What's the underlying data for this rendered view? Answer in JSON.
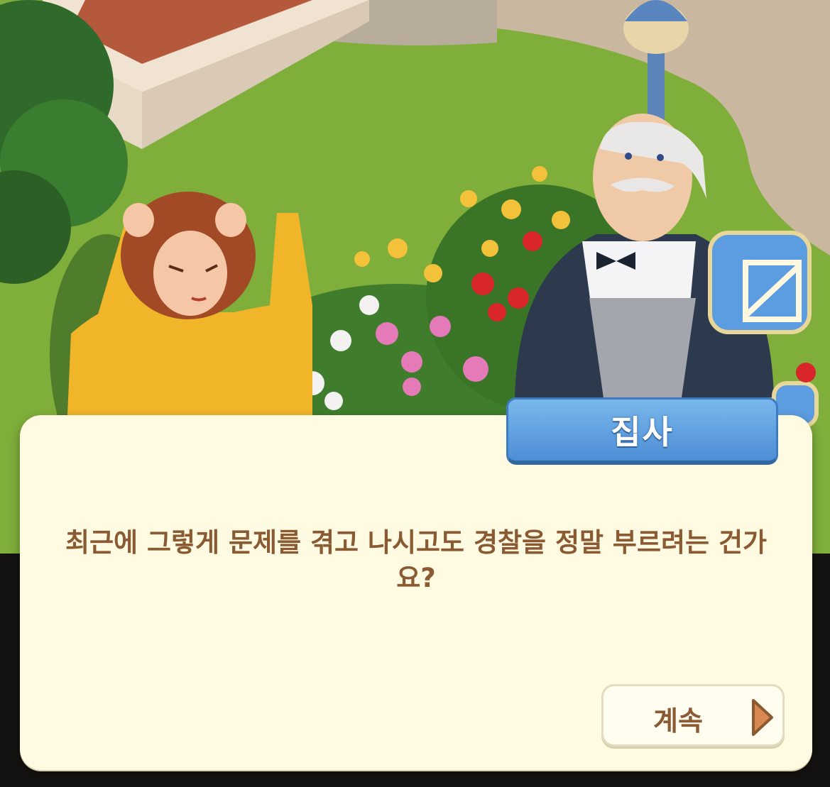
{
  "dialog": {
    "speaker_name": "집사",
    "text": "최근에 그렇게 문제를 겪고 나시고도 경찰을 정말 부르려는 건가요?",
    "continue_label": "계속"
  },
  "colors": {
    "dialog_bg": "#fffbe2",
    "dialog_text": "#8a5a33",
    "name_tab": "#4d8ed5",
    "lawn": "#7fae3a"
  },
  "icons": [
    "mail-icon",
    "chevron-right-icon"
  ]
}
